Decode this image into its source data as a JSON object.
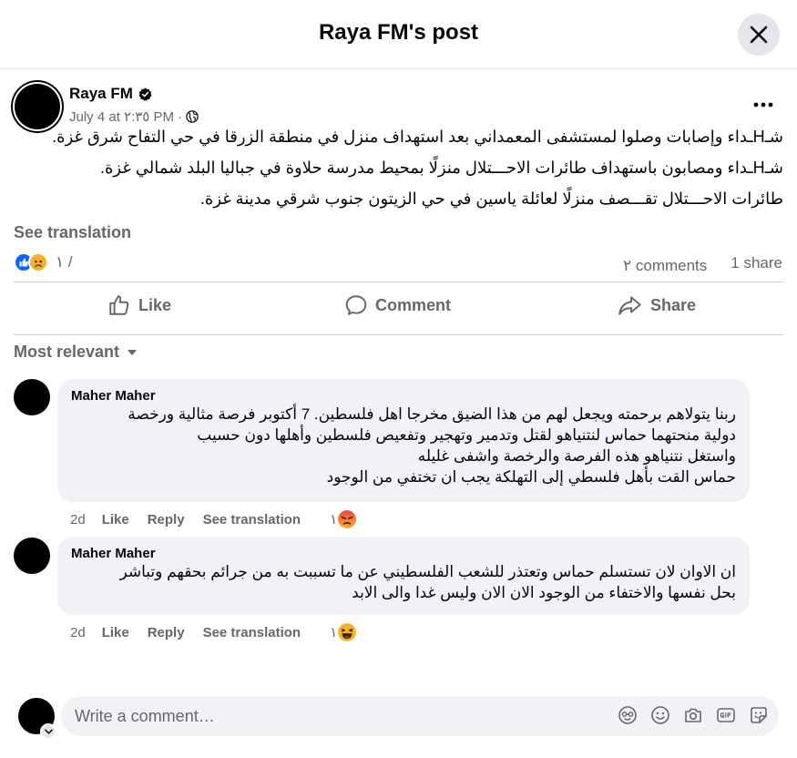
{
  "header": {
    "title": "Raya FM's post"
  },
  "post": {
    "author": "Raya FM",
    "date": "July 4 at ٢:٣٥ PM",
    "lines": [
      "شـHـداء وإصابات وصلوا لمستشفى المعمداني بعد استهداف منزل في منطقة الزرقا في حي التفاح شرق غزة.",
      "شـHـداء ومصابون باستهداف طائرات الاحـــتلال منزلًا بمحيط مدرسة حلاوة في جباليا البلد شمالي غزة.",
      "طائرات الاحـــتلال تقـــصف منزلًا لعائلة ياسين في حي الزيتون جنوب شرقي مدينة غزة."
    ],
    "see_translation": "See translation",
    "reaction_count": "١ /",
    "comments_count": "٢ comments",
    "shares_count": "1 share"
  },
  "actions": {
    "like": "Like",
    "comment": "Comment",
    "share": "Share"
  },
  "filter": {
    "label": "Most relevant"
  },
  "comments": [
    {
      "author": "Maher Maher",
      "lines": [
        "ربنا يتولاهم برحمته ويجعل لهم من هذا الضيق مخرجا اهل فلسطين. 7 أكتوبر فرصة مثالية ورخصة",
        "دولية منحتهما حماس لنتنياهو لقتل وتدمير وتهجير وتفعيص فلسطين وأهلها دون حسيب",
        "واستغل نتنياهو هذه الفرصة والرخصة واشفى غليله",
        "حماس القت بأهل فلسطي إلى التهلكة يجب ان تختفي من الوجود"
      ],
      "time": "2d",
      "like": "Like",
      "reply": "Reply",
      "see_translation": "See translation",
      "reaction_count": "١",
      "reaction": "angry"
    },
    {
      "author": "Maher Maher",
      "lines": [
        "ان الاوان لان تستسلم حماس وتعتذر للشعب الفلسطيني عن ما تسببت به من جرائم بحقهم وتباشر",
        "بحل نفسها والاختفاء من الوجود الان الان وليس غدا والى الابد"
      ],
      "time": "2d",
      "like": "Like",
      "reply": "Reply",
      "see_translation": "See translation",
      "reaction_count": "١",
      "reaction": "haha"
    }
  ],
  "composer": {
    "placeholder": "Write a comment…"
  },
  "icons": {
    "close": "close-icon",
    "verified": "verified-badge-icon",
    "globe": "globe-icon",
    "more": "more-icon",
    "like_reaction": "like-reaction-icon",
    "sad_reaction": "sad-reaction-icon",
    "like": "thumbs-up-icon",
    "comment": "comment-bubble-icon",
    "share": "share-arrow-icon",
    "dropdown": "caret-down-icon",
    "avatar_sticker": "avatar-sticker-icon",
    "emoji": "emoji-icon",
    "camera": "camera-icon",
    "gif": "gif-icon",
    "sticker": "sticker-icon"
  },
  "colors": {
    "accent": "#0866ff",
    "secondary_text": "#65676b",
    "bubble": "#f0f2f5",
    "angry": "#f0433a",
    "haha": "#f7b125"
  }
}
